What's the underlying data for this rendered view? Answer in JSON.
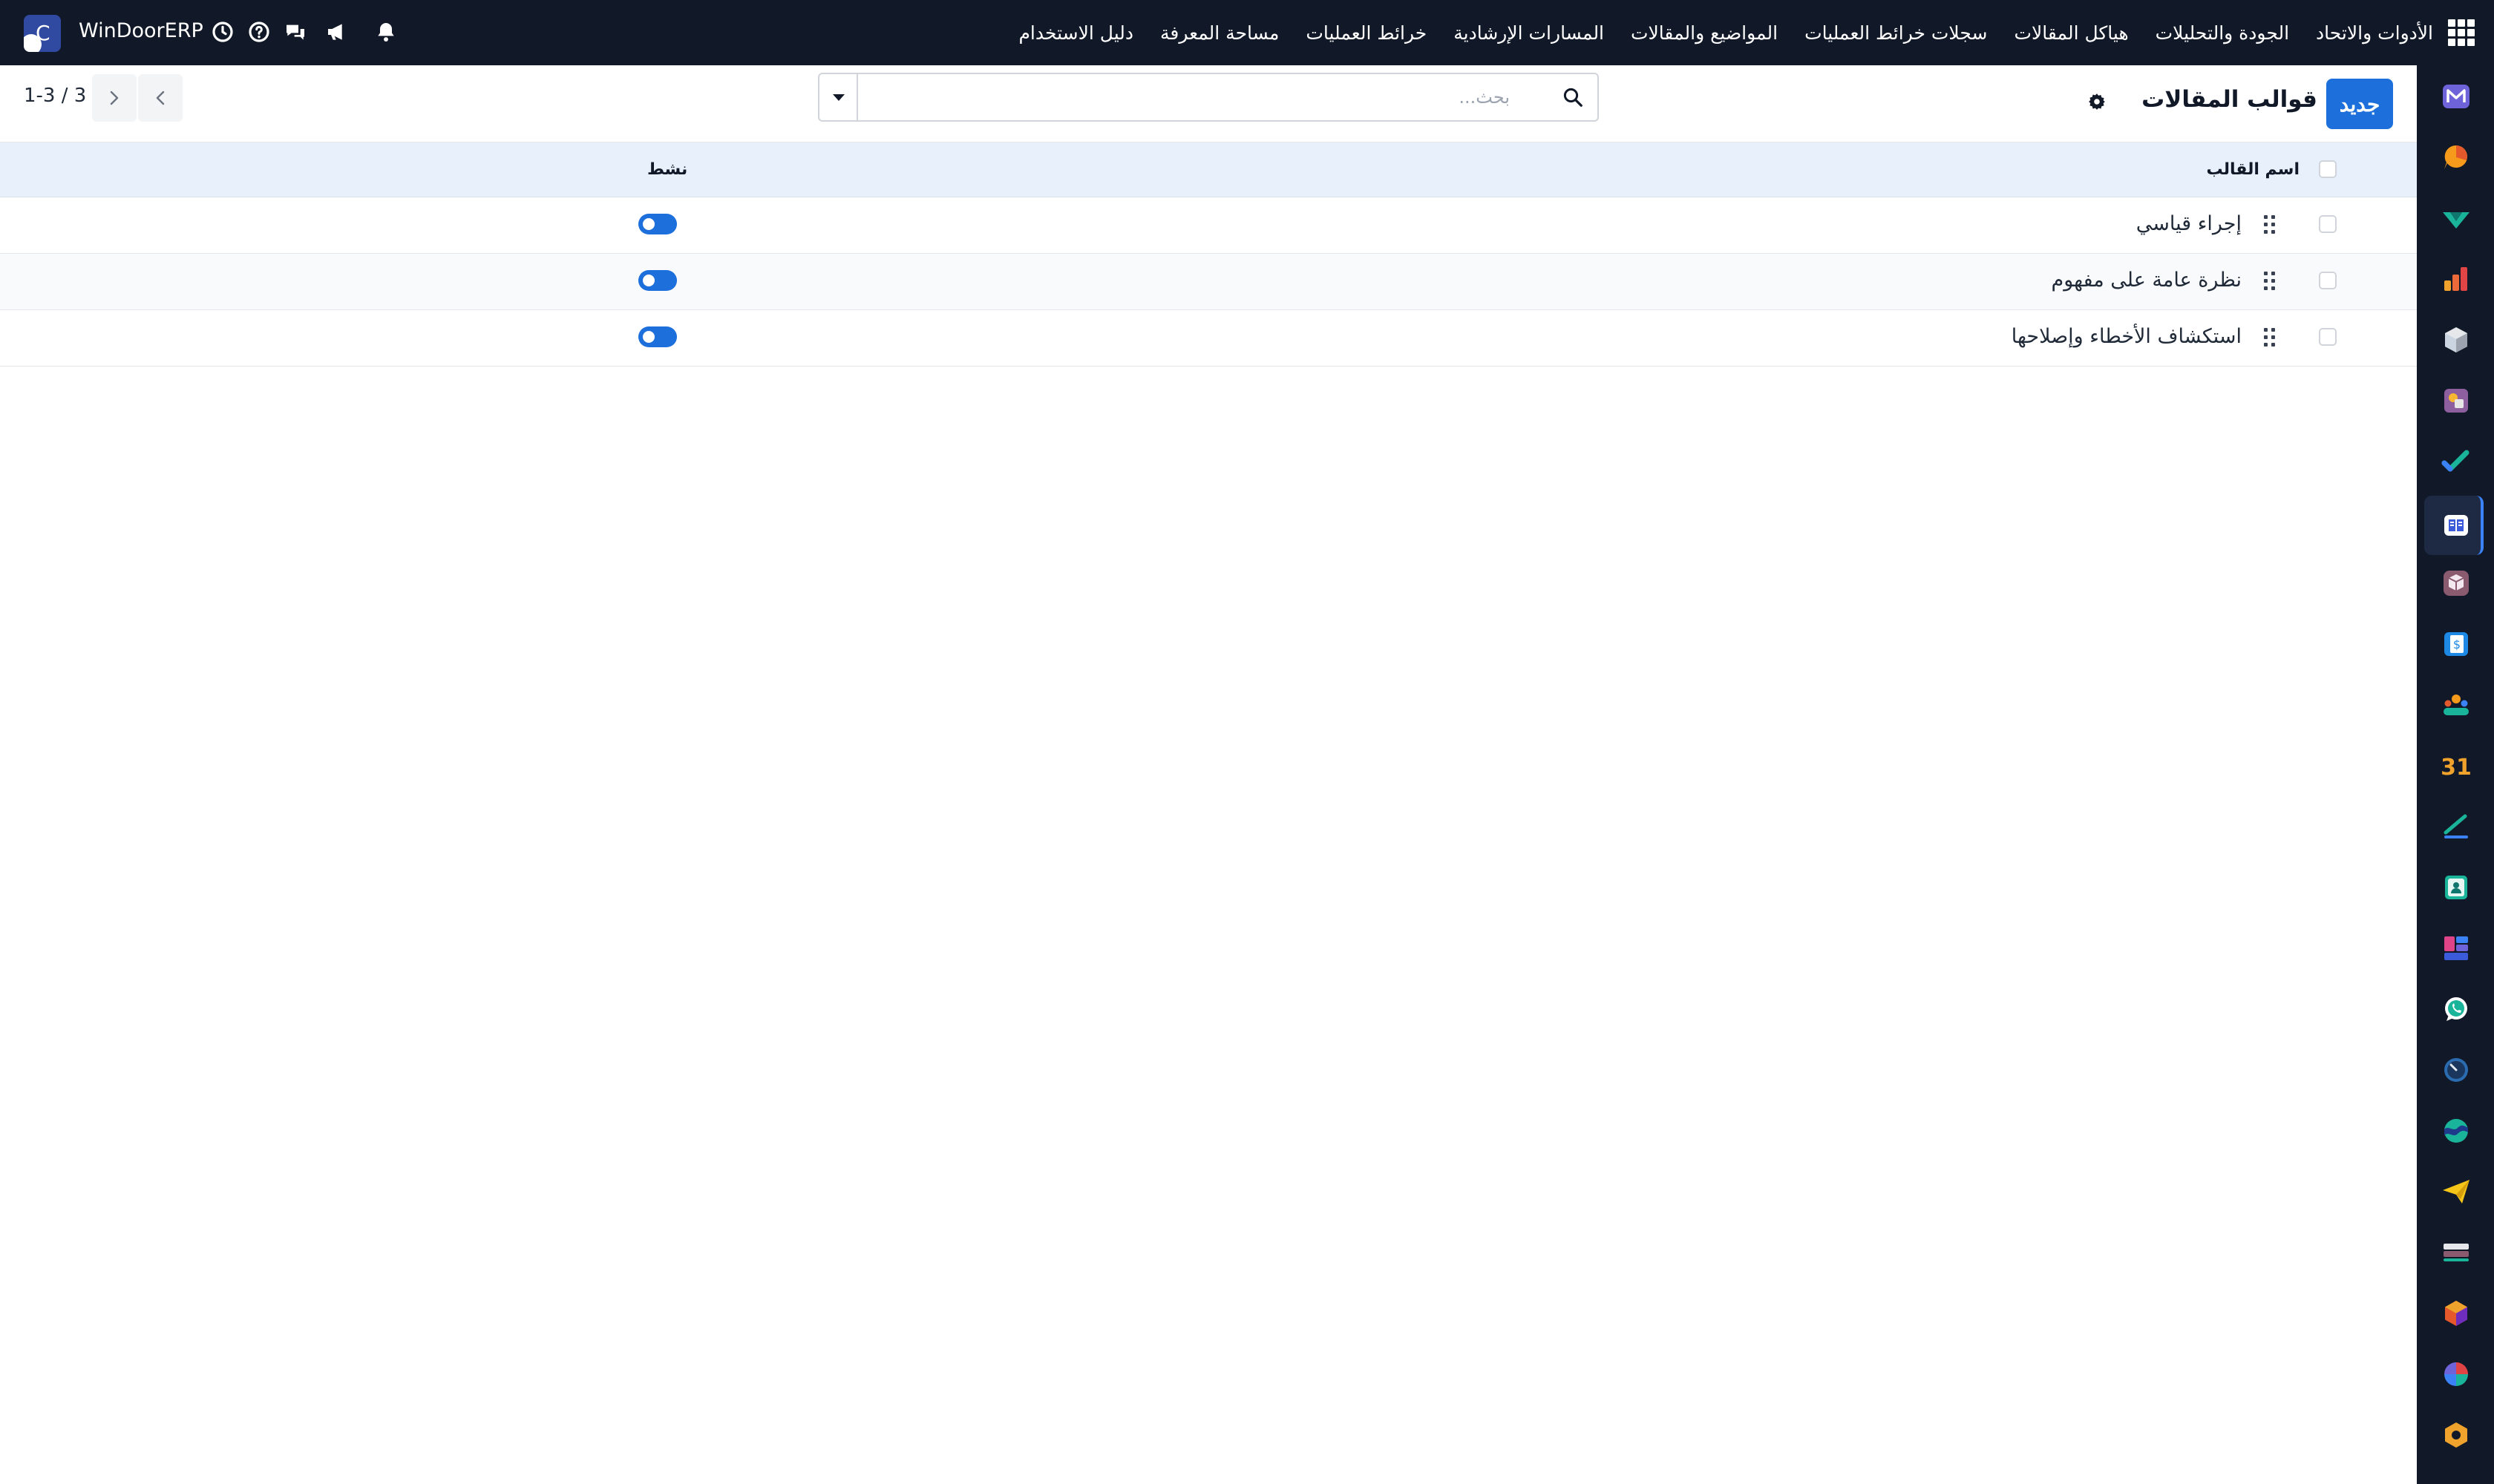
{
  "app": {
    "brand_name": "WinDoorERP"
  },
  "nav": {
    "items": [
      "دليل الاستخدام",
      "مساحة المعرفة",
      "خرائط العمليات",
      "المسارات الإرشادية",
      "المواضيع والمقالات",
      "سجلات خرائط العمليات",
      "هياكل المقالات",
      "الجودة والتحليلات",
      "الأدوات والاتحاد"
    ]
  },
  "control": {
    "new_label": "جديد",
    "title": "قوالب المقالات",
    "search_placeholder": "بحث...",
    "pager_value": "1-3 / 3"
  },
  "table": {
    "col_name": "اسم القالب",
    "col_active": "نشط",
    "rows": [
      {
        "name": "إجراء قياسي",
        "active": true
      },
      {
        "name": "نظرة عامة على مفهوم",
        "active": true
      },
      {
        "name": "استكشاف الأخطاء وإصلاحها",
        "active": true
      }
    ]
  },
  "colors": {
    "topbar": "#111827",
    "accent": "#1d6fdc",
    "header_row": "#e7f0fb"
  },
  "icons": {
    "topbar": [
      "apps-grid-icon",
      "bell-icon",
      "megaphone-icon",
      "chat-icon",
      "help-icon",
      "clock-icon"
    ],
    "sidebar_apps": [
      "mail-app-icon",
      "chat-bubble-app-icon",
      "check-app-icon",
      "bar-chart-app-icon",
      "cube-app-icon",
      "image-app-icon",
      "task-check-app-icon",
      "knowledge-app-icon",
      "box-app-icon",
      "invoice-app-icon",
      "team-app-icon",
      "calendar-app-icon",
      "sign-app-icon",
      "contacts-app-icon",
      "dashboard-app-icon",
      "whatsapp-app-icon",
      "clock-app-icon",
      "wave-app-icon",
      "send-app-icon",
      "layers-app-icon",
      "hexagon-app-icon",
      "pie-app-icon",
      "settings-hex-app-icon"
    ]
  }
}
